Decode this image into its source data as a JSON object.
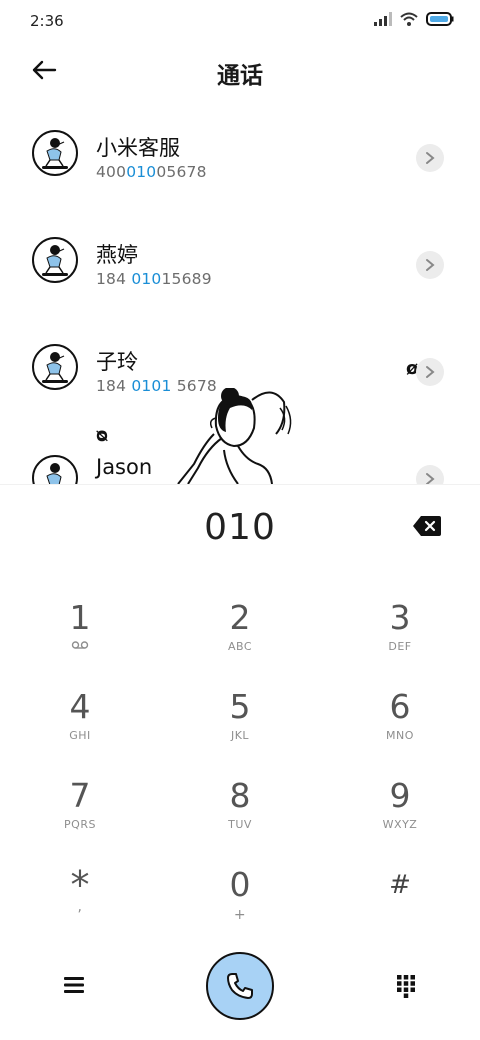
{
  "status": {
    "time": "2:36",
    "icons": [
      "signal-icon",
      "wifi-icon",
      "battery-icon"
    ]
  },
  "header": {
    "title": "通话",
    "back_icon": "arrow-left-icon"
  },
  "contacts": [
    {
      "name": "小米客服",
      "number_parts": [
        "400",
        "010",
        "05678"
      ]
    },
    {
      "name": "燕婷",
      "number_parts": [
        "184 ",
        "010",
        "15689"
      ]
    },
    {
      "name": "子玲",
      "number_parts": [
        "184 ",
        "0101",
        " 5678"
      ]
    },
    {
      "name": "Jason",
      "number_parts": [
        "",
        "",
        ""
      ]
    }
  ],
  "marks": {
    "top": "ø",
    "bottom": "ᴓ"
  },
  "dialer": {
    "number": "010"
  },
  "keypad": [
    {
      "digit": "1",
      "letters": ""
    },
    {
      "digit": "2",
      "letters": "ABC"
    },
    {
      "digit": "3",
      "letters": "DEF"
    },
    {
      "digit": "4",
      "letters": "GHI"
    },
    {
      "digit": "5",
      "letters": "JKL"
    },
    {
      "digit": "6",
      "letters": "MNO"
    },
    {
      "digit": "7",
      "letters": "PQRS"
    },
    {
      "digit": "8",
      "letters": "TUV"
    },
    {
      "digit": "9",
      "letters": "WXYZ"
    },
    {
      "digit": "*",
      "letters": ","
    },
    {
      "digit": "0",
      "letters": "+"
    },
    {
      "digit": "#",
      "letters": ""
    }
  ],
  "colors": {
    "highlight": "#1a8ed6",
    "call_button": "#a8d2f5"
  }
}
